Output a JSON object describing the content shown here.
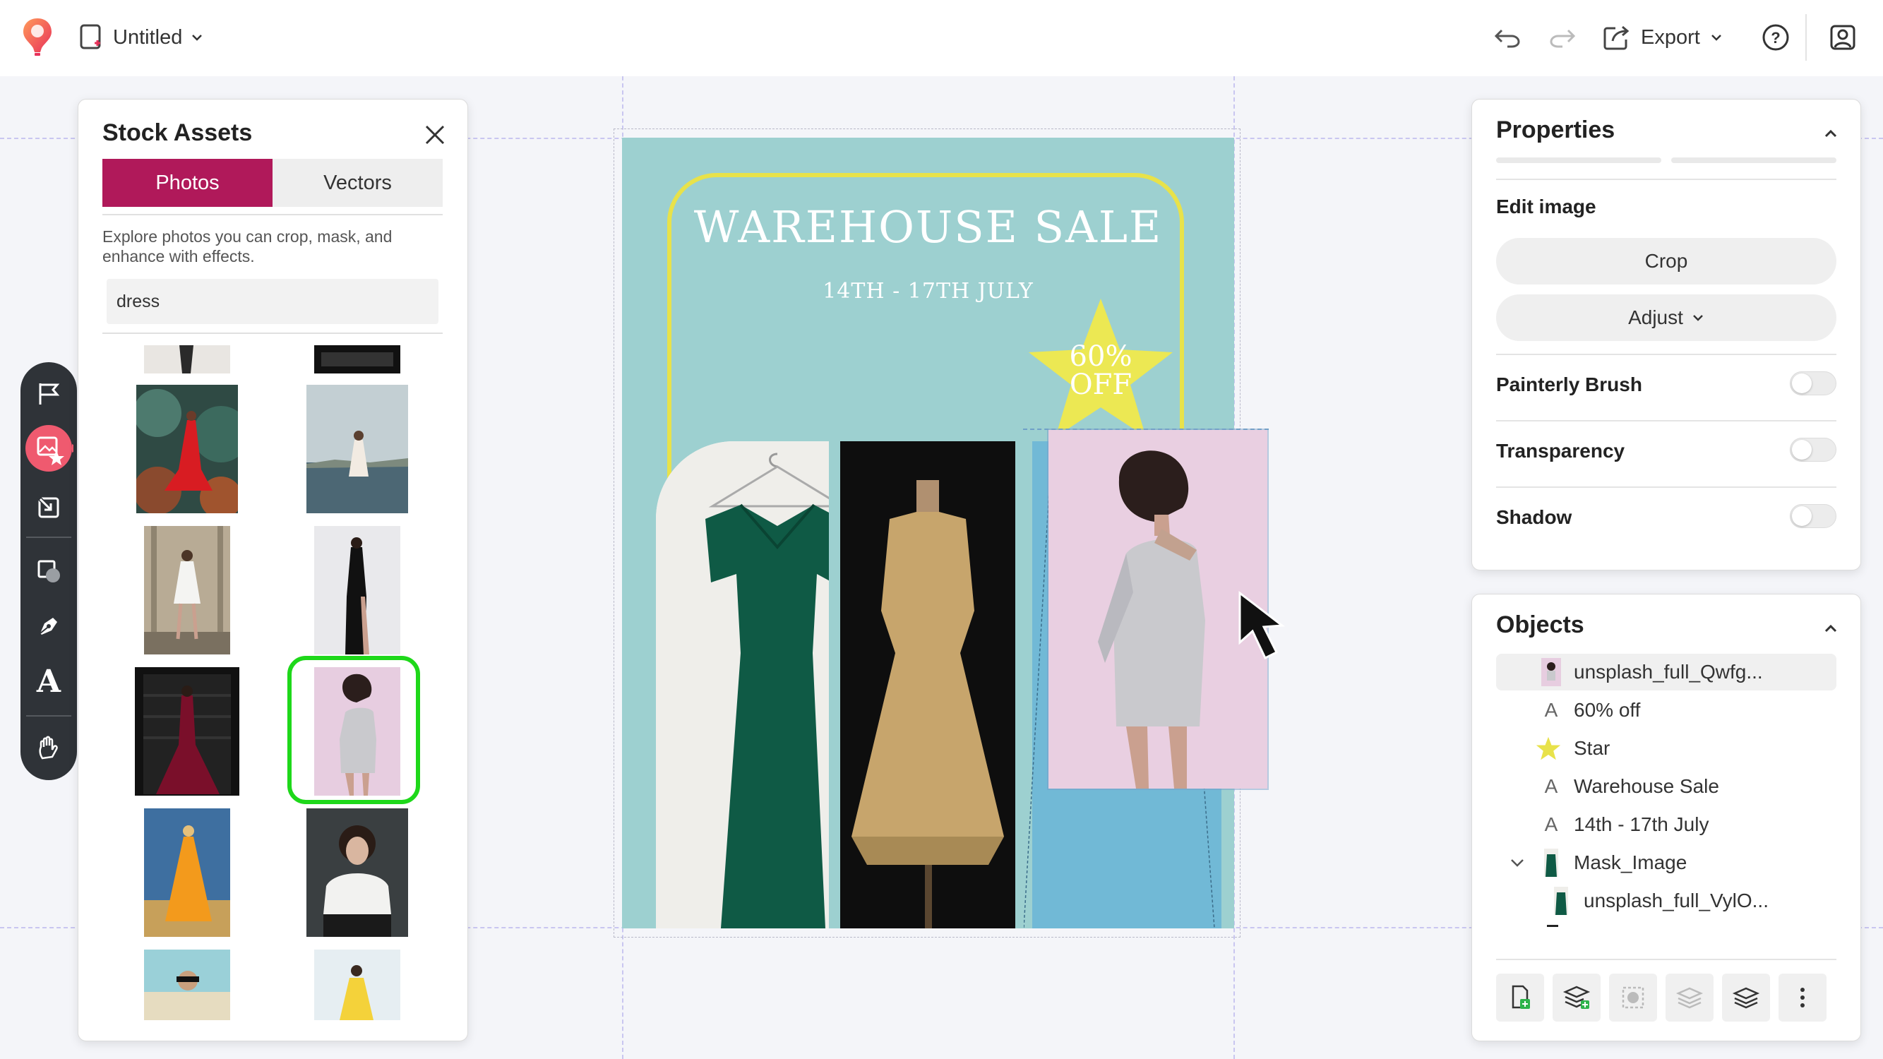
{
  "app": {
    "document_title": "Untitled",
    "export_label": "Export"
  },
  "stock_assets": {
    "title": "Stock Assets",
    "tabs": [
      "Photos",
      "Vectors"
    ],
    "active_tab": "Photos",
    "description": "Explore photos you can crop, mask, and enhance with effects.",
    "search_value": "dress",
    "accent_color": "#b0195a",
    "highlight_color": "#1ed81a"
  },
  "poster": {
    "title": "WAREHOUSE SALE",
    "date": "14TH - 17TH JULY",
    "badge_line1": "60%",
    "badge_line2": "OFF",
    "background": "#9dd0d0",
    "frame_color": "#e8e24a"
  },
  "properties": {
    "title": "Properties",
    "edit_image_label": "Edit image",
    "crop_label": "Crop",
    "adjust_label": "Adjust",
    "toggles": [
      {
        "label": "Painterly Brush",
        "on": false
      },
      {
        "label": "Transparency",
        "on": false
      },
      {
        "label": "Shadow",
        "on": false
      }
    ]
  },
  "objects": {
    "title": "Objects",
    "items": [
      {
        "label": "unsplash_full_Qwfg...",
        "icon": "image-thumb-icon",
        "selected": true
      },
      {
        "label": "60% off",
        "icon": "text-icon"
      },
      {
        "label": "Star",
        "icon": "star-icon"
      },
      {
        "label": "Warehouse Sale",
        "icon": "text-icon"
      },
      {
        "label": "14th - 17th July",
        "icon": "text-icon"
      },
      {
        "label": "Mask_Image",
        "icon": "mask-thumb-icon",
        "expanded": true
      },
      {
        "label": "unsplash_full_VylO...",
        "icon": "image-thumb-icon",
        "child": true
      }
    ]
  },
  "tool_rail": {
    "items": [
      "flag-icon",
      "stock-assets-icon",
      "import-icon",
      "shapes-icon",
      "pen-icon",
      "text-tool-icon",
      "hand-icon"
    ],
    "active": "stock-assets-icon",
    "text_tool_glyph": "A"
  }
}
